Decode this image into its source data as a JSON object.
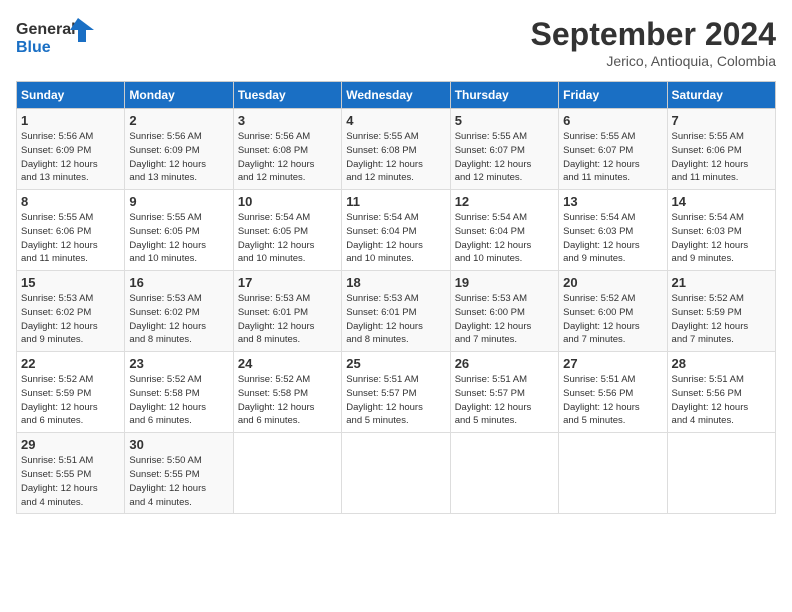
{
  "logo": {
    "line1": "General",
    "line2": "Blue"
  },
  "title": "September 2024",
  "subtitle": "Jerico, Antioquia, Colombia",
  "weekdays": [
    "Sunday",
    "Monday",
    "Tuesday",
    "Wednesday",
    "Thursday",
    "Friday",
    "Saturday"
  ],
  "weeks": [
    [
      {
        "day": "1",
        "info": "Sunrise: 5:56 AM\nSunset: 6:09 PM\nDaylight: 12 hours\nand 13 minutes."
      },
      {
        "day": "2",
        "info": "Sunrise: 5:56 AM\nSunset: 6:09 PM\nDaylight: 12 hours\nand 13 minutes."
      },
      {
        "day": "3",
        "info": "Sunrise: 5:56 AM\nSunset: 6:08 PM\nDaylight: 12 hours\nand 12 minutes."
      },
      {
        "day": "4",
        "info": "Sunrise: 5:55 AM\nSunset: 6:08 PM\nDaylight: 12 hours\nand 12 minutes."
      },
      {
        "day": "5",
        "info": "Sunrise: 5:55 AM\nSunset: 6:07 PM\nDaylight: 12 hours\nand 12 minutes."
      },
      {
        "day": "6",
        "info": "Sunrise: 5:55 AM\nSunset: 6:07 PM\nDaylight: 12 hours\nand 11 minutes."
      },
      {
        "day": "7",
        "info": "Sunrise: 5:55 AM\nSunset: 6:06 PM\nDaylight: 12 hours\nand 11 minutes."
      }
    ],
    [
      {
        "day": "8",
        "info": "Sunrise: 5:55 AM\nSunset: 6:06 PM\nDaylight: 12 hours\nand 11 minutes."
      },
      {
        "day": "9",
        "info": "Sunrise: 5:55 AM\nSunset: 6:05 PM\nDaylight: 12 hours\nand 10 minutes."
      },
      {
        "day": "10",
        "info": "Sunrise: 5:54 AM\nSunset: 6:05 PM\nDaylight: 12 hours\nand 10 minutes."
      },
      {
        "day": "11",
        "info": "Sunrise: 5:54 AM\nSunset: 6:04 PM\nDaylight: 12 hours\nand 10 minutes."
      },
      {
        "day": "12",
        "info": "Sunrise: 5:54 AM\nSunset: 6:04 PM\nDaylight: 12 hours\nand 10 minutes."
      },
      {
        "day": "13",
        "info": "Sunrise: 5:54 AM\nSunset: 6:03 PM\nDaylight: 12 hours\nand 9 minutes."
      },
      {
        "day": "14",
        "info": "Sunrise: 5:54 AM\nSunset: 6:03 PM\nDaylight: 12 hours\nand 9 minutes."
      }
    ],
    [
      {
        "day": "15",
        "info": "Sunrise: 5:53 AM\nSunset: 6:02 PM\nDaylight: 12 hours\nand 9 minutes."
      },
      {
        "day": "16",
        "info": "Sunrise: 5:53 AM\nSunset: 6:02 PM\nDaylight: 12 hours\nand 8 minutes."
      },
      {
        "day": "17",
        "info": "Sunrise: 5:53 AM\nSunset: 6:01 PM\nDaylight: 12 hours\nand 8 minutes."
      },
      {
        "day": "18",
        "info": "Sunrise: 5:53 AM\nSunset: 6:01 PM\nDaylight: 12 hours\nand 8 minutes."
      },
      {
        "day": "19",
        "info": "Sunrise: 5:53 AM\nSunset: 6:00 PM\nDaylight: 12 hours\nand 7 minutes."
      },
      {
        "day": "20",
        "info": "Sunrise: 5:52 AM\nSunset: 6:00 PM\nDaylight: 12 hours\nand 7 minutes."
      },
      {
        "day": "21",
        "info": "Sunrise: 5:52 AM\nSunset: 5:59 PM\nDaylight: 12 hours\nand 7 minutes."
      }
    ],
    [
      {
        "day": "22",
        "info": "Sunrise: 5:52 AM\nSunset: 5:59 PM\nDaylight: 12 hours\nand 6 minutes."
      },
      {
        "day": "23",
        "info": "Sunrise: 5:52 AM\nSunset: 5:58 PM\nDaylight: 12 hours\nand 6 minutes."
      },
      {
        "day": "24",
        "info": "Sunrise: 5:52 AM\nSunset: 5:58 PM\nDaylight: 12 hours\nand 6 minutes."
      },
      {
        "day": "25",
        "info": "Sunrise: 5:51 AM\nSunset: 5:57 PM\nDaylight: 12 hours\nand 5 minutes."
      },
      {
        "day": "26",
        "info": "Sunrise: 5:51 AM\nSunset: 5:57 PM\nDaylight: 12 hours\nand 5 minutes."
      },
      {
        "day": "27",
        "info": "Sunrise: 5:51 AM\nSunset: 5:56 PM\nDaylight: 12 hours\nand 5 minutes."
      },
      {
        "day": "28",
        "info": "Sunrise: 5:51 AM\nSunset: 5:56 PM\nDaylight: 12 hours\nand 4 minutes."
      }
    ],
    [
      {
        "day": "29",
        "info": "Sunrise: 5:51 AM\nSunset: 5:55 PM\nDaylight: 12 hours\nand 4 minutes."
      },
      {
        "day": "30",
        "info": "Sunrise: 5:50 AM\nSunset: 5:55 PM\nDaylight: 12 hours\nand 4 minutes."
      },
      null,
      null,
      null,
      null,
      null
    ]
  ]
}
